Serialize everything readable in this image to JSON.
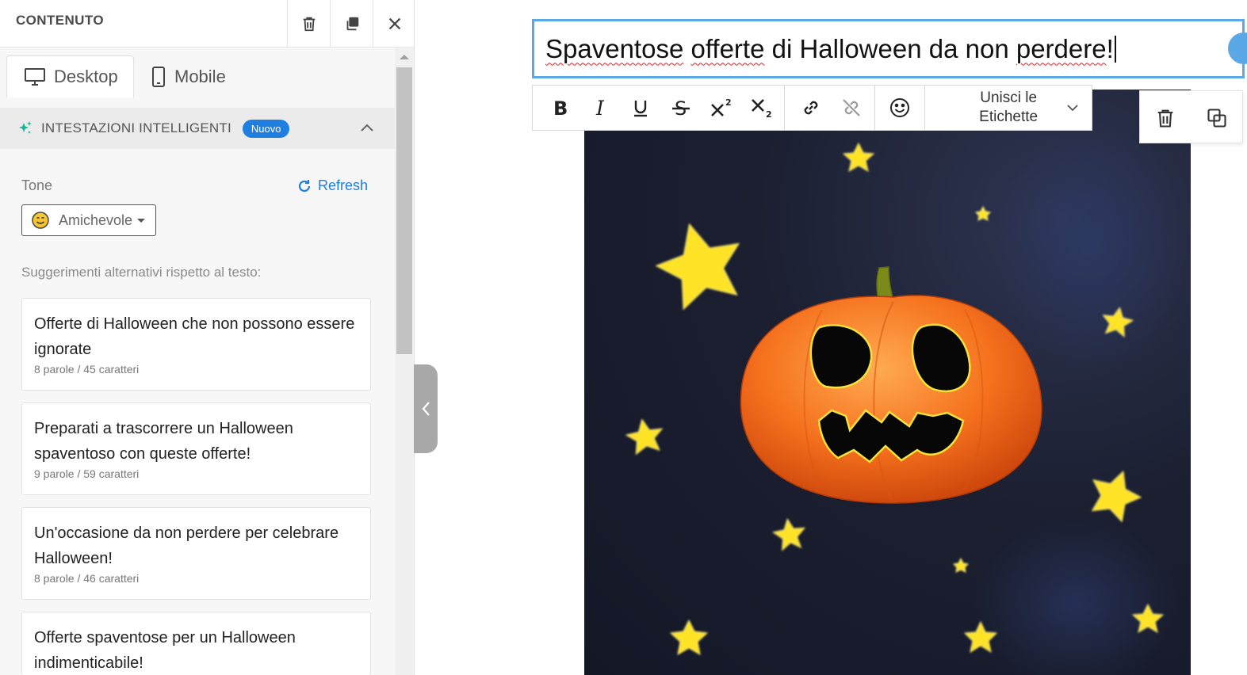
{
  "panel": {
    "title": "CONTENUTO",
    "tabs": [
      {
        "label": "Desktop",
        "active": true
      },
      {
        "label": "Mobile",
        "active": false
      }
    ],
    "smart_headers": {
      "title": "INTESTAZIONI INTELLIGENTI",
      "badge": "Nuovo"
    },
    "tone": {
      "label": "Tone",
      "refresh_label": "Refresh",
      "selected": "Amichevole"
    },
    "suggestions_label": "Suggerimenti alternativi rispetto al testo:",
    "suggestions": [
      {
        "text": "Offerte di Halloween che non possono essere ignorate",
        "meta": "8 parole / 45 caratteri"
      },
      {
        "text": "Preparati a trascorrere un Halloween spaventoso con queste offerte!",
        "meta": "9 parole / 59 caratteri"
      },
      {
        "text": "Un'occasione da non perdere per celebrare Halloween!",
        "meta": "8 parole / 46 caratteri"
      },
      {
        "text": "Offerte spaventose per un Halloween indimenticabile!",
        "meta": ""
      }
    ]
  },
  "editor": {
    "headline": {
      "w1": "Spaventose",
      "w2": "offerte",
      "w3": "di Halloween da non",
      "w4": "perdere",
      "w5": "!"
    },
    "toolbar": {
      "merge_line1": "Unisci le",
      "merge_line2": "Etichette"
    }
  },
  "colors": {
    "accent": "#1f7fe0",
    "focus_border": "#5aa9e6",
    "smart_icon": "#19b394"
  }
}
